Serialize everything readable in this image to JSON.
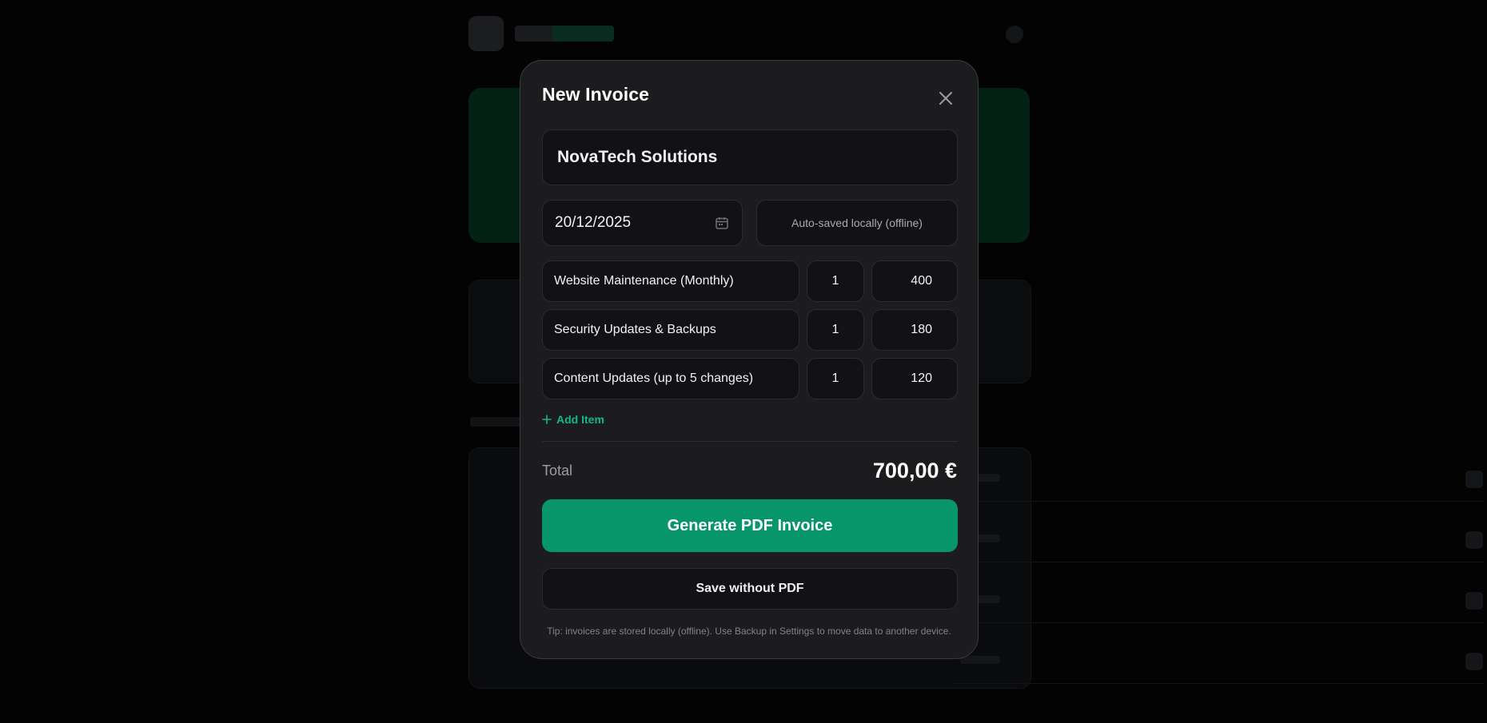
{
  "modal": {
    "title": "New Invoice",
    "close_icon": "close-icon"
  },
  "form": {
    "client_name": "NovaTech Solutions",
    "date": "20/12/2025",
    "date_icon": "calendar-icon",
    "autosave_status": "Auto-saved locally (offline)"
  },
  "items": [
    {
      "description": "Website Maintenance (Monthly)",
      "qty": "1",
      "price": "400"
    },
    {
      "description": "Security Updates & Backups",
      "qty": "1",
      "price": "180"
    },
    {
      "description": "Content Updates (up to 5 changes)",
      "qty": "1",
      "price": "120"
    }
  ],
  "add_item": {
    "label": "Add Item",
    "icon": "plus-icon"
  },
  "summary": {
    "total_label": "Total",
    "total_value": "700,00 €"
  },
  "actions": {
    "generate_label": "Generate PDF Invoice",
    "save_label": "Save without PDF"
  },
  "tip": "Tip: invoices are stored locally (offline). Use Backup in Settings to move data to another device.",
  "colors": {
    "accent": "#069669",
    "accent_text": "#14b886",
    "modal_bg": "#1c1c1f",
    "field_bg": "#121214",
    "page_bg": "#030303"
  }
}
